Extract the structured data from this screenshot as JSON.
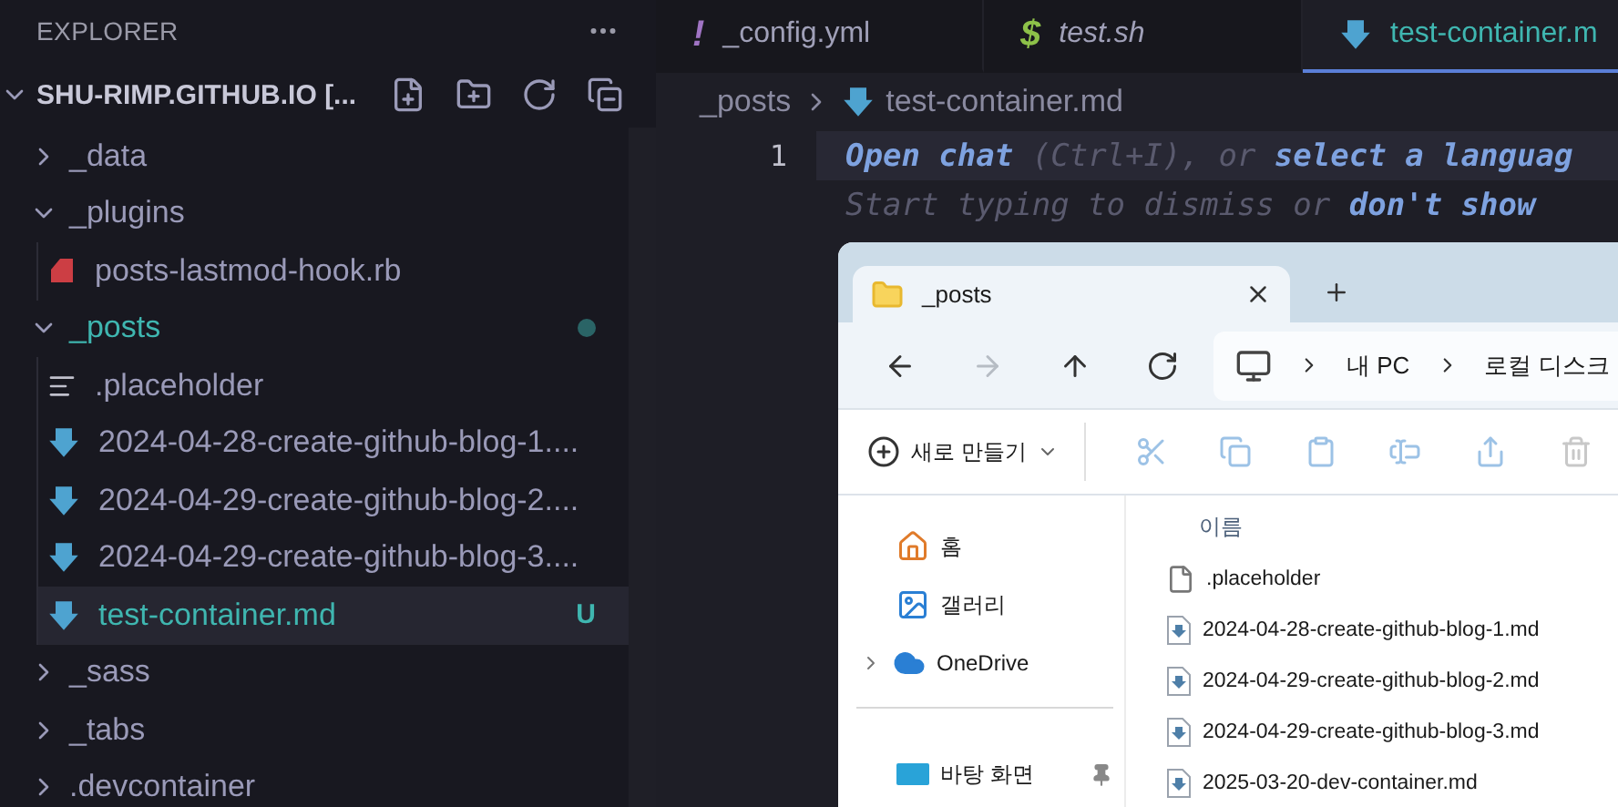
{
  "sidebar": {
    "title": "EXPLORER",
    "root": {
      "label": "SHU-RIMP.GITHUB.IO [...",
      "expanded": true,
      "children": [
        {
          "label": "_data",
          "kind": "folder",
          "expanded": false,
          "selected": false
        },
        {
          "label": "_plugins",
          "kind": "folder",
          "expanded": true,
          "selected": false,
          "children": [
            {
              "label": "posts-lastmod-hook.rb",
              "kind": "ruby",
              "selected": false
            }
          ]
        },
        {
          "label": "_posts",
          "kind": "folder",
          "expanded": true,
          "selected": false,
          "untracked": true,
          "modified": true,
          "children": [
            {
              "label": ".placeholder",
              "kind": "text",
              "selected": false
            },
            {
              "label": "2024-04-28-create-github-blog-1....",
              "kind": "markdown",
              "selected": false
            },
            {
              "label": "2024-04-29-create-github-blog-2....",
              "kind": "markdown",
              "selected": false
            },
            {
              "label": "2024-04-29-create-github-blog-3....",
              "kind": "markdown",
              "selected": false
            },
            {
              "label": "test-container.md",
              "kind": "markdown",
              "selected": true,
              "untracked": true,
              "badge": "U"
            }
          ]
        },
        {
          "label": "_sass",
          "kind": "folder",
          "expanded": false,
          "selected": false
        },
        {
          "label": "_tabs",
          "kind": "folder",
          "expanded": false,
          "selected": false
        },
        {
          "label": ".devcontainer",
          "kind": "folder",
          "expanded": false,
          "selected": false
        }
      ]
    }
  },
  "tabs": [
    {
      "glyph": "!",
      "kind": "yaml",
      "label": "_config.yml",
      "preview": false,
      "selected": false
    },
    {
      "glyph": "$",
      "kind": "shell",
      "label": "test.sh",
      "preview": true,
      "selected": false
    },
    {
      "kind": "markdown",
      "label": "test-container.m",
      "preview": false,
      "selected": true
    }
  ],
  "breadcrumb": {
    "folder": "_posts",
    "file": "test-container.md"
  },
  "editor": {
    "lines": [
      {
        "number": "1",
        "current": true,
        "segments": [
          {
            "text": "Open chat",
            "link": true
          },
          {
            "text": " (Ctrl+I), or ",
            "link": false
          },
          {
            "text": "select a languag",
            "link": true
          }
        ]
      },
      {
        "current": false,
        "segments": [
          {
            "text": "Start typing to dismiss or ",
            "link": false
          },
          {
            "text": "don't show ",
            "link": true
          }
        ]
      }
    ]
  },
  "file_explorer": {
    "tabs": [
      {
        "label": "_posts",
        "selected": true
      }
    ],
    "nav_buttons": [
      {
        "kind": "back",
        "disabled": false
      },
      {
        "kind": "forward",
        "disabled": true
      },
      {
        "kind": "up",
        "disabled": false
      },
      {
        "kind": "refresh",
        "disabled": false
      }
    ],
    "address": [
      "내 PC",
      "로컬 디스크"
    ],
    "toolbar": {
      "new_label": "새로 만들기",
      "actions": [
        {
          "kind": "cut",
          "disabled": true
        },
        {
          "kind": "copy",
          "disabled": true
        },
        {
          "kind": "paste",
          "disabled": true
        },
        {
          "kind": "rename",
          "disabled": true
        },
        {
          "kind": "share",
          "disabled": true
        },
        {
          "kind": "delete",
          "disabled": true
        }
      ]
    },
    "nav_pane": [
      [
        {
          "label": "홈",
          "kind": "home"
        },
        {
          "label": "갤러리",
          "kind": "gallery"
        },
        {
          "label": "OneDrive",
          "kind": "cloud",
          "expandable": true
        }
      ],
      [
        {
          "label": "바탕 화면",
          "kind": "desktop",
          "pinned": true
        }
      ]
    ],
    "files": {
      "column": "이름",
      "items": [
        {
          "name": ".placeholder",
          "kind": "text"
        },
        {
          "name": "2024-04-28-create-github-blog-1.md",
          "kind": "markdown"
        },
        {
          "name": "2024-04-29-create-github-blog-2.md",
          "kind": "markdown"
        },
        {
          "name": "2024-04-29-create-github-blog-3.md",
          "kind": "markdown"
        },
        {
          "name": "2025-03-20-dev-container.md",
          "kind": "markdown"
        }
      ]
    }
  }
}
